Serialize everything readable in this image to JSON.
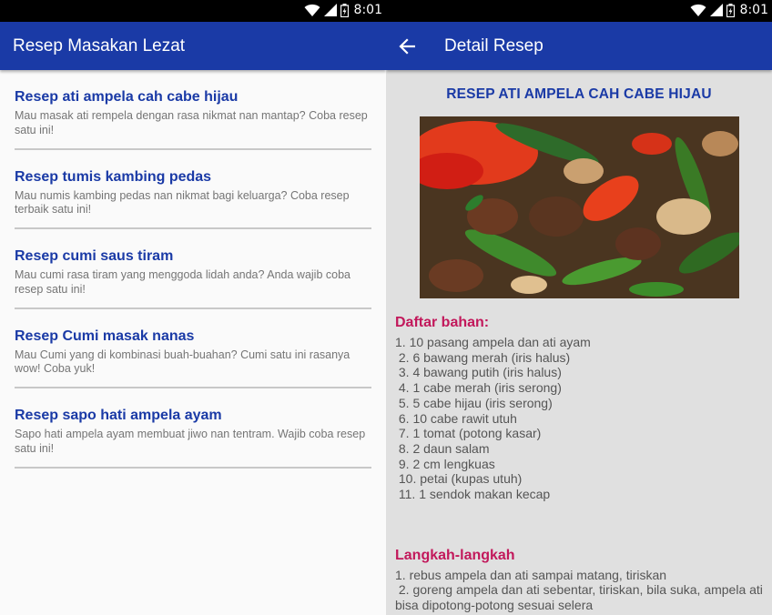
{
  "colors": {
    "primary": "#1a3aa6",
    "accent": "#c2185b",
    "status_bar": "#000000"
  },
  "left_screen": {
    "status": {
      "time": "8:01",
      "icons": [
        "wifi-icon",
        "signal-icon",
        "battery-icon"
      ]
    },
    "app_title": "Resep Masakan Lezat",
    "recipes": [
      {
        "title": "Resep ati ampela cah cabe hijau",
        "desc": "Mau masak ati rempela dengan rasa nikmat nan mantap? Coba resep satu ini!"
      },
      {
        "title": "Resep tumis kambing pedas",
        "desc": "Mau numis kambing pedas nan nikmat bagi keluarga? Coba resep terbaik satu ini!"
      },
      {
        "title": "Resep cumi saus tiram",
        "desc": "Mau cumi rasa tiram yang menggoda lidah anda? Anda wajib coba resep satu ini!"
      },
      {
        "title": "Resep Cumi masak nanas",
        "desc": "Mau Cumi yang di kombinasi buah-buahan? Cumi satu ini rasanya wow! Coba yuk!"
      },
      {
        "title": "Resep sapo hati ampela ayam",
        "desc": "Sapo hati ampela ayam membuat jiwo nan tentram. Wajib coba resep satu ini!"
      }
    ]
  },
  "right_screen": {
    "status": {
      "time": "8:01",
      "icons": [
        "wifi-icon",
        "signal-icon",
        "battery-icon"
      ]
    },
    "app_title": "Detail Resep",
    "back_icon": "arrow-back-icon",
    "recipe_title": "RESEP ATI AMPELA CAH CABE HIJAU",
    "ingredients_heading": "Daftar bahan:",
    "ingredients": [
      "1. 10 pasang ampela dan ati ayam",
      " 2. 6 bawang merah (iris halus)",
      " 3. 4 bawang putih (iris halus)",
      " 4. 1 cabe merah (iris serong)",
      " 5. 5 cabe hijau (iris serong)",
      " 6. 10 cabe rawit utuh",
      " 7. 1 tomat (potong kasar)",
      " 8. 2 daun salam",
      " 9. 2 cm lengkuas",
      " 10. petai (kupas utuh)",
      " 11. 1 sendok makan kecap"
    ],
    "steps_heading": "Langkah-langkah",
    "steps": [
      "1. rebus ampela dan ati sampai matang, tiriskan",
      " 2. goreng ampela dan ati sebentar, tiriskan, bila suka, ampela ati bisa dipotong-potong sesuai selera"
    ]
  }
}
